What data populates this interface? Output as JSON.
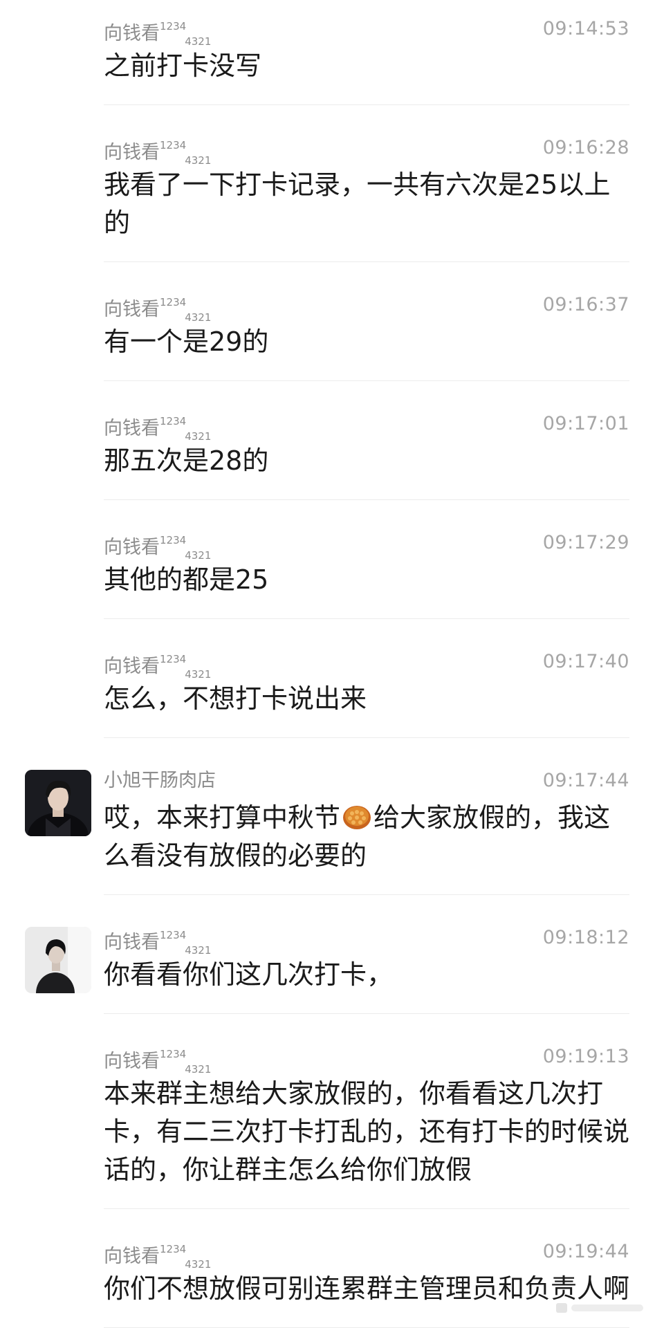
{
  "messages": [
    {
      "sender": "向钱看",
      "sup": "1234",
      "sub": "4321",
      "time": "09:14:53",
      "text": "之前打卡没写"
    },
    {
      "sender": "向钱看",
      "sup": "1234",
      "sub": "4321",
      "time": "09:16:28",
      "text": "我看了一下打卡记录，一共有六次是25以上的"
    },
    {
      "sender": "向钱看",
      "sup": "1234",
      "sub": "4321",
      "time": "09:16:37",
      "text": "有一个是29的"
    },
    {
      "sender": "向钱看",
      "sup": "1234",
      "sub": "4321",
      "time": "09:17:01",
      "text": "那五次是28的"
    },
    {
      "sender": "向钱看",
      "sup": "1234",
      "sub": "4321",
      "time": "09:17:29",
      "text": "其他的都是25"
    },
    {
      "sender": "向钱看",
      "sup": "1234",
      "sub": "4321",
      "time": "09:17:40",
      "text": "怎么，不想打卡说出来"
    },
    {
      "sender": "小旭干肠肉店",
      "time": "09:17:44",
      "text_before": "哎，本来打算中秋节",
      "text_after": "给大家放假的，我这么看没有放假的必要的",
      "emoji": "mooncake-icon"
    },
    {
      "sender": "向钱看",
      "sup": "1234",
      "sub": "4321",
      "time": "09:18:12",
      "text": "你看看你们这几次打卡，"
    },
    {
      "sender": "向钱看",
      "sup": "1234",
      "sub": "4321",
      "time": "09:19:13",
      "text": "本来群主想给大家放假的，你看看这几次打卡，有二三次打卡打乱的，还有打卡的时候说话的，你让群主怎么给你们放假"
    },
    {
      "sender": "向钱看",
      "sup": "1234",
      "sub": "4321",
      "time": "09:19:44",
      "text": "你们不想放假可别连累群主管理员和负责人啊"
    }
  ],
  "colors": {
    "sender": "#8c8c8c",
    "time": "#a6a6a6",
    "text": "#1a1a1a",
    "divider": "#ececec",
    "background": "#ffffff"
  }
}
